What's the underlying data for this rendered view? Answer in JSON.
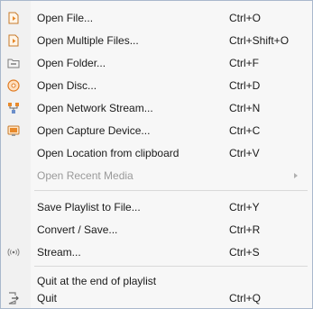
{
  "menu": {
    "items": [
      {
        "label": "Open File...",
        "shortcut": "Ctrl+O",
        "icon": "file-icon"
      },
      {
        "label": "Open Multiple Files...",
        "shortcut": "Ctrl+Shift+O",
        "icon": "multiple-files-icon"
      },
      {
        "label": "Open Folder...",
        "shortcut": "Ctrl+F",
        "icon": "folder-icon"
      },
      {
        "label": "Open Disc...",
        "shortcut": "Ctrl+D",
        "icon": "disc-icon"
      },
      {
        "label": "Open Network Stream...",
        "shortcut": "Ctrl+N",
        "icon": "network-icon"
      },
      {
        "label": "Open Capture Device...",
        "shortcut": "Ctrl+C",
        "icon": "capture-device-icon"
      },
      {
        "label": "Open Location from clipboard",
        "shortcut": "Ctrl+V",
        "icon": ""
      },
      {
        "label": "Open Recent Media",
        "shortcut": "",
        "icon": "",
        "disabled": true,
        "submenu": true
      },
      {
        "label": "Save Playlist to File...",
        "shortcut": "Ctrl+Y",
        "icon": ""
      },
      {
        "label": "Convert / Save...",
        "shortcut": "Ctrl+R",
        "icon": ""
      },
      {
        "label": "Stream...",
        "shortcut": "Ctrl+S",
        "icon": "stream-icon"
      },
      {
        "label": "Quit at the end of playlist",
        "shortcut": "",
        "icon": ""
      },
      {
        "label": "Quit",
        "shortcut": "Ctrl+Q",
        "icon": "quit-icon"
      }
    ]
  },
  "colors": {
    "menu_bg": "#f7f7f7",
    "border": "#a9b8cc",
    "disabled_text": "#9a9a9a",
    "icon_orange": "#e8892a"
  }
}
